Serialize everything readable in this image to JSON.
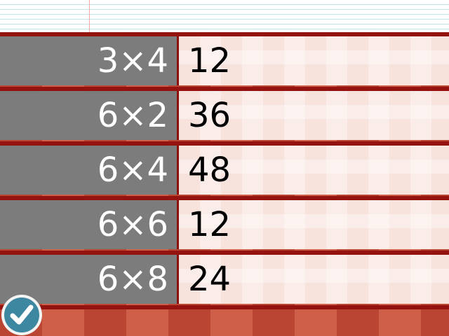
{
  "rows": [
    {
      "question": "3×4",
      "answer": "12"
    },
    {
      "question": "6×2",
      "answer": "36"
    },
    {
      "question": "6×4",
      "answer": "48"
    },
    {
      "question": "6×6",
      "answer": "12"
    },
    {
      "question": "6×8",
      "answer": "24"
    }
  ],
  "check_button": {
    "icon": "check-icon"
  },
  "colors": {
    "question_bg": "#7c7c7c",
    "answer_bg": "#f7e2dc",
    "tablecloth": "#cf5f49",
    "stripe_dark": "#8b0f0b",
    "check_button_fill": "#3e87a0"
  }
}
